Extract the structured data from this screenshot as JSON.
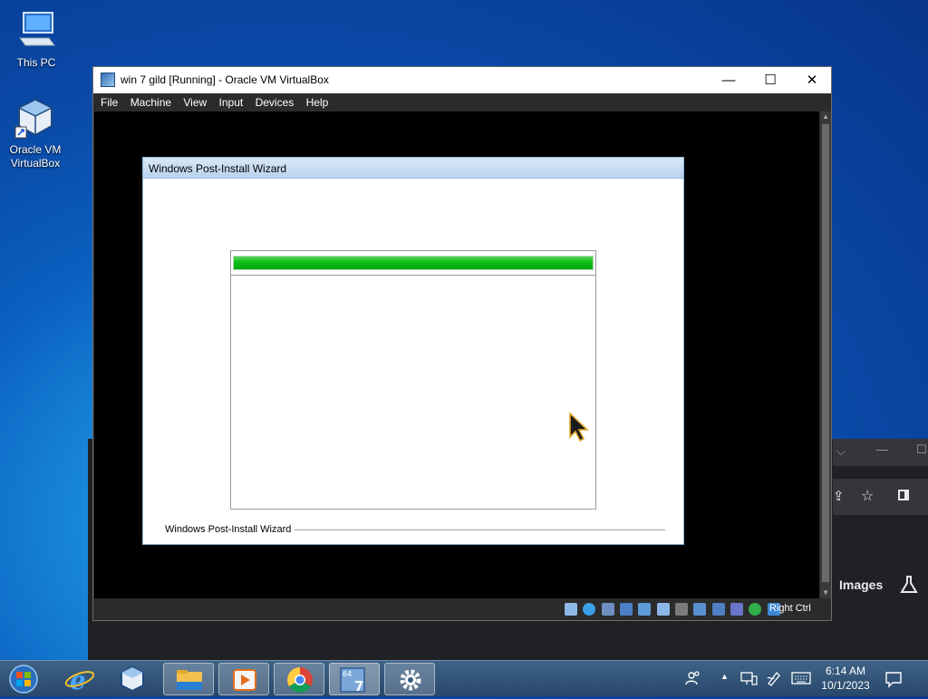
{
  "desktop": {
    "icons": [
      {
        "label": "This PC"
      },
      {
        "label": "Oracle VM VirtualBox"
      }
    ]
  },
  "background_browser": {
    "images_label": "Images"
  },
  "vbox_window": {
    "title": "win 7 gild [Running] - Oracle VM VirtualBox",
    "menu": [
      "File",
      "Machine",
      "View",
      "Input",
      "Devices",
      "Help"
    ],
    "host_key": "Right Ctrl",
    "controls": {
      "minimize": "—",
      "maximize": "☐",
      "close": "✕"
    }
  },
  "guest": {
    "wizard_title": "Windows Post-Install Wizard",
    "footer_label": "Windows Post-Install Wizard",
    "progress_fraction": 1.0,
    "progress_color": "#0bbf14"
  },
  "taskbar": {
    "apps": [
      "start-orb",
      "internet-explorer",
      "virtualbox",
      "file-explorer",
      "media-player",
      "chrome",
      "windows7-64",
      "settings"
    ],
    "clock": {
      "time": "6:14 AM",
      "date": "10/1/2023"
    }
  }
}
